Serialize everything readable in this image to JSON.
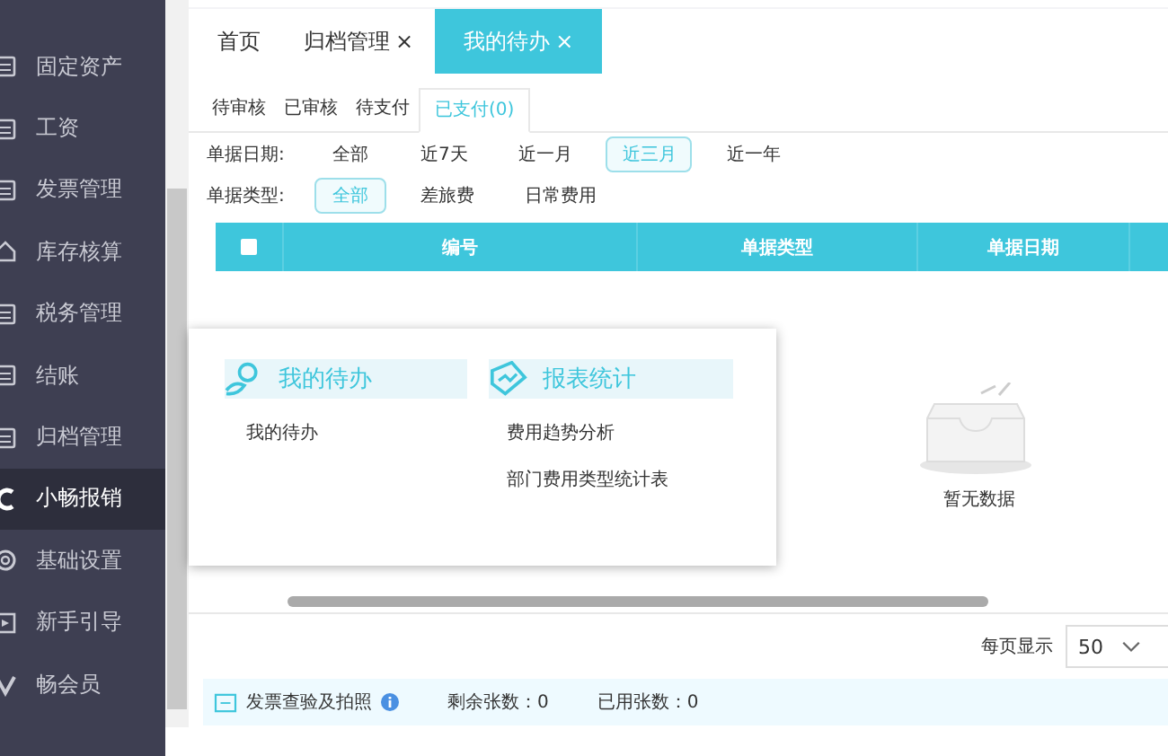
{
  "sidebar": {
    "items": [
      {
        "label": "固定资产",
        "kind": "doc",
        "selected": false
      },
      {
        "label": "工资",
        "kind": "doc",
        "selected": false
      },
      {
        "label": "发票管理",
        "kind": "doc",
        "selected": false
      },
      {
        "label": "库存核算",
        "kind": "house",
        "selected": false
      },
      {
        "label": "税务管理",
        "kind": "doc",
        "selected": false
      },
      {
        "label": "结账",
        "kind": "doc",
        "selected": false
      },
      {
        "label": "归档管理",
        "kind": "doc",
        "selected": false
      },
      {
        "label": "小畅报销",
        "kind": "logo",
        "selected": true
      },
      {
        "label": "基础设置",
        "kind": "gear",
        "selected": false
      },
      {
        "label": "新手引导",
        "kind": "play",
        "selected": false
      },
      {
        "label": "畅会员",
        "kind": "vip",
        "selected": false
      }
    ]
  },
  "tabs": [
    {
      "label": "首页",
      "closable": false,
      "selected": false
    },
    {
      "label": "归档管理",
      "closable": true,
      "selected": false
    },
    {
      "label": "我的待办",
      "closable": true,
      "selected": true
    }
  ],
  "close_glyph": "×",
  "subtabs": [
    {
      "label": "待审核",
      "selected": false
    },
    {
      "label": "已审核",
      "selected": false
    },
    {
      "label": "待支付",
      "selected": false
    },
    {
      "label": "已支付(0)",
      "selected": true
    }
  ],
  "filters": [
    {
      "label": "单据日期:",
      "options": [
        {
          "label": "全部",
          "selected": false
        },
        {
          "label": "近7天",
          "selected": false
        },
        {
          "label": "近一月",
          "selected": false
        },
        {
          "label": "近三月",
          "selected": true
        },
        {
          "label": "近一年",
          "selected": false
        }
      ]
    },
    {
      "label": "单据类型:",
      "options": [
        {
          "label": "全部",
          "selected": true
        },
        {
          "label": "差旅费",
          "selected": false
        },
        {
          "label": "日常费用",
          "selected": false
        }
      ]
    }
  ],
  "table": {
    "columns": [
      "编号",
      "单据类型",
      "单据日期"
    ],
    "checked": false,
    "empty_text": "暂无数据"
  },
  "popup": {
    "sections": [
      {
        "title": "我的待办",
        "kind": "person",
        "links": [
          "我的待办"
        ]
      },
      {
        "title": "报表统计",
        "kind": "report",
        "links": [
          "费用趋势分析",
          "部门费用类型统计表"
        ]
      }
    ]
  },
  "pagination": {
    "label": "每页显示",
    "page_size": "50"
  },
  "footer": {
    "label": "发票查验及拍照",
    "remaining": "剩余张数：0",
    "used": "已用张数：0"
  }
}
